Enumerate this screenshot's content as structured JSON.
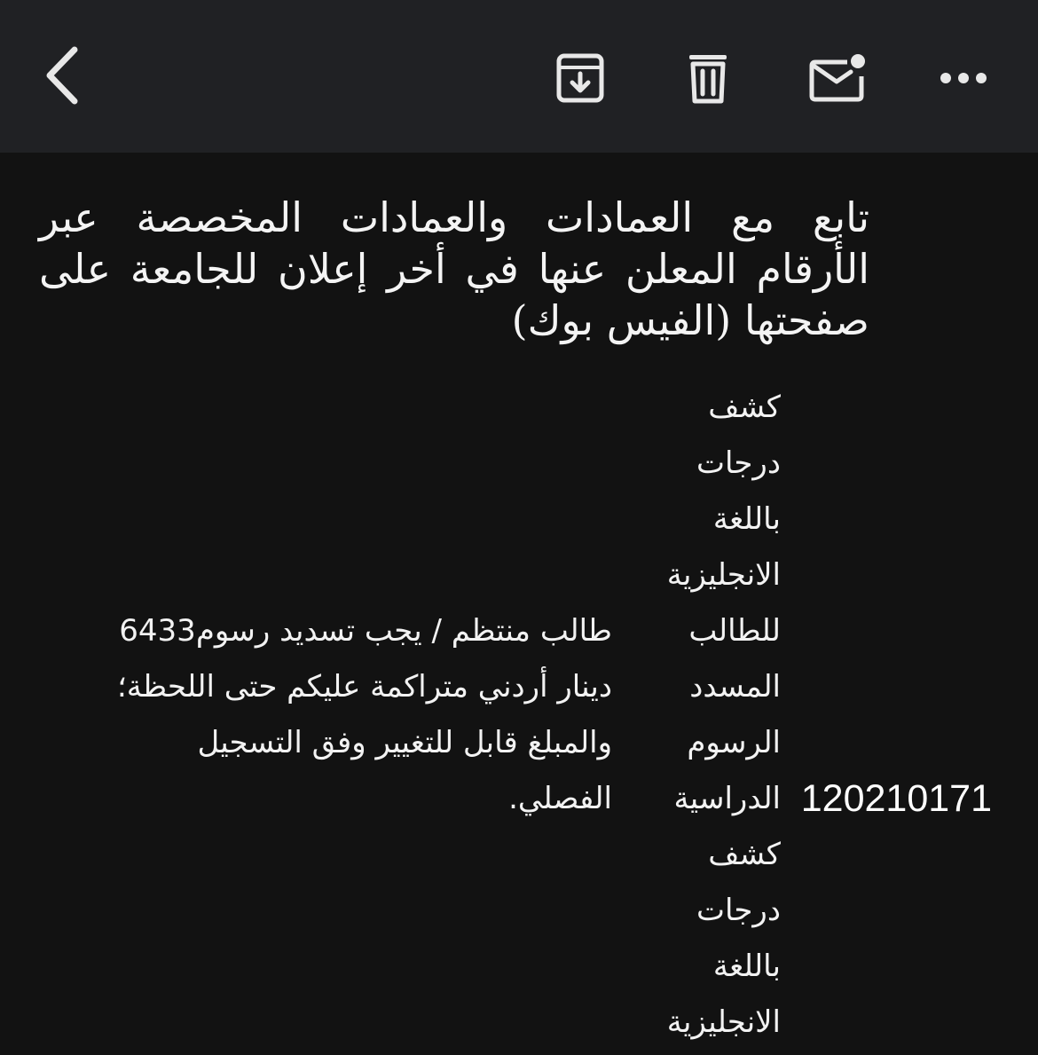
{
  "toolbar": {
    "back_icon": "chevron-left-icon",
    "archive_icon": "archive-icon",
    "delete_icon": "trash-icon",
    "mark_unread_icon": "mail-unread-icon",
    "more_icon": "more-horizontal-icon"
  },
  "email": {
    "notice": "تابع مع العمادات والعمادات المخصصة عبر الأرقام المعلن عنها في أخر إعلان للجامعة على صفحتها (الفيس بوك)",
    "label_lines_top": [
      "كشف",
      "درجات",
      "باللغة",
      "الانجليزية",
      "للطالب",
      "المسدد",
      "الرسوم",
      "الدراسية"
    ],
    "status_lines": [
      "طالب منتظم / يجب تسديد رسوم6433",
      "دينار أردني متراكمة عليكم حتى اللحظة؛",
      "والمبلغ قابل للتغيير وفق التسجيل",
      "الفصلي."
    ],
    "student_id": "120210171",
    "label_lines_bottom": [
      "كشف",
      "درجات",
      "باللغة",
      "الانجليزية"
    ]
  },
  "colors": {
    "toolbar_bg": "#202124",
    "content_bg": "#121212",
    "text": "#f2f2f2",
    "icon": "#e8e8e8"
  }
}
